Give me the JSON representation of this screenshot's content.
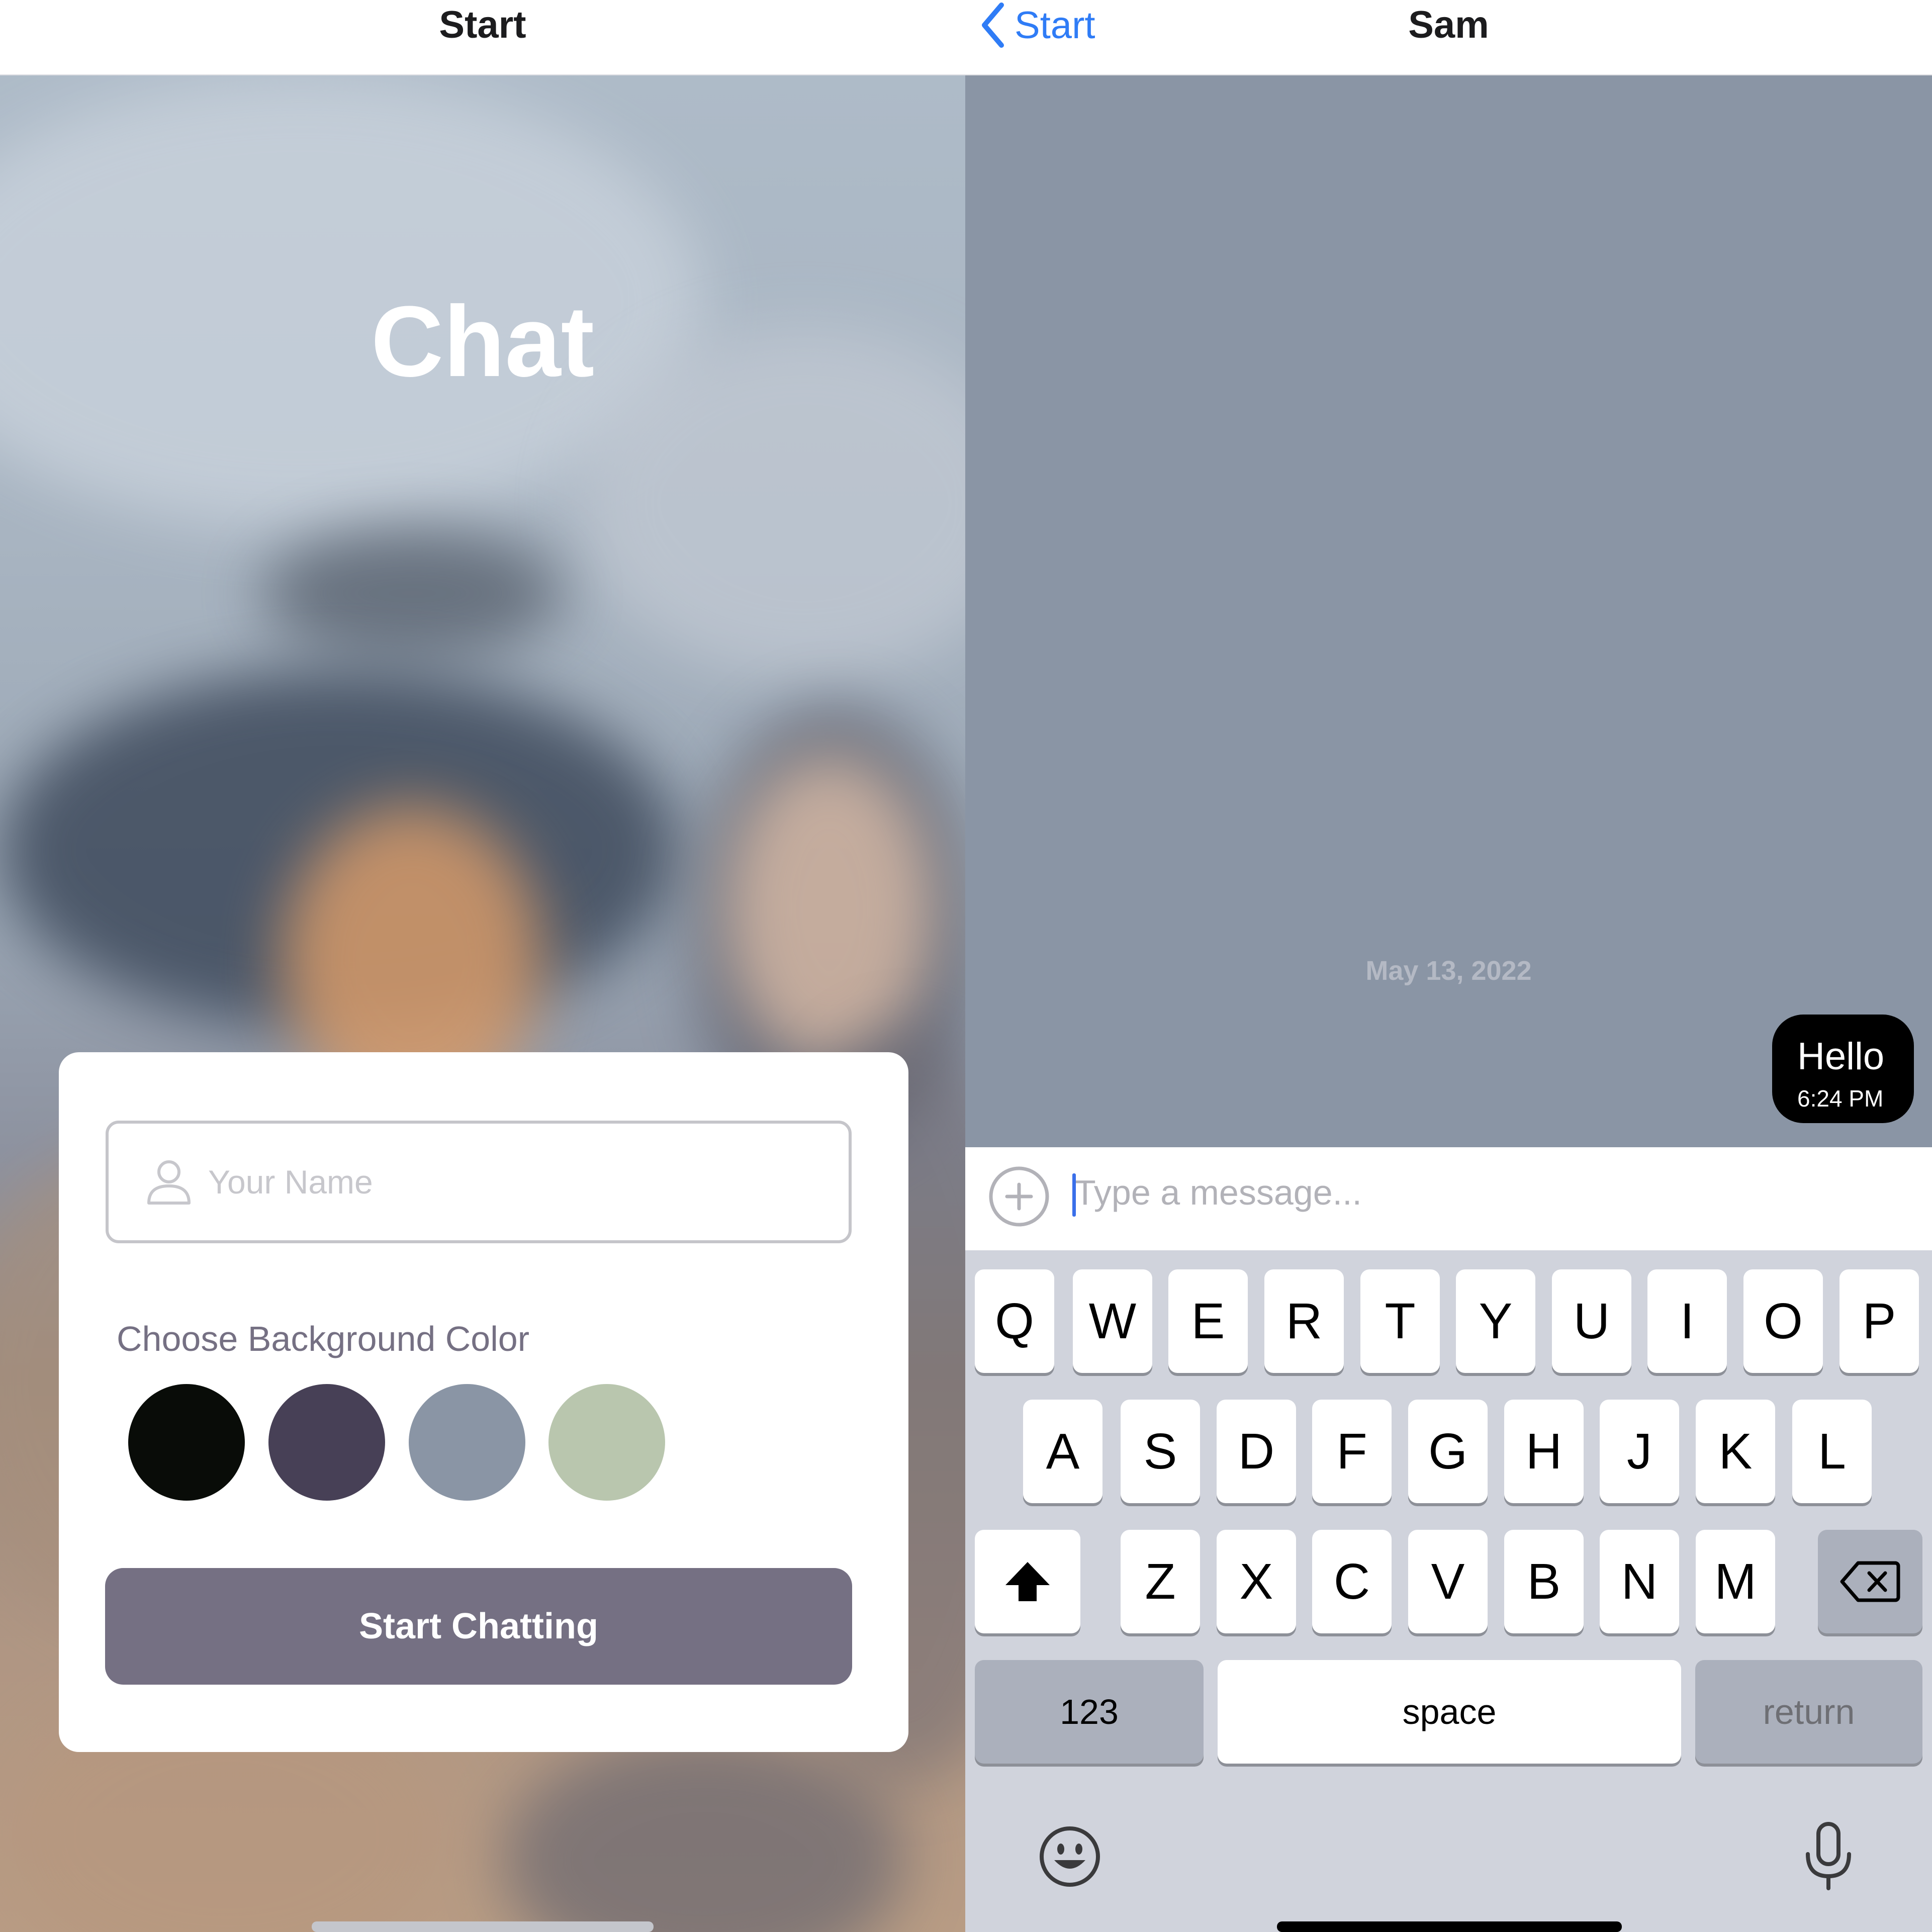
{
  "left": {
    "nav_title": "Start",
    "app_title": "Chat",
    "name_input": {
      "placeholder": "Your Name",
      "value": ""
    },
    "color_label": "Choose Background Color",
    "swatches": [
      {
        "color": "#090C08",
        "name": "black"
      },
      {
        "color": "#474056",
        "name": "dark-purple"
      },
      {
        "color": "#8A95A5",
        "name": "slate-gray"
      },
      {
        "color": "#B9C6AE",
        "name": "sage-green"
      }
    ],
    "start_button_label": "Start Chatting",
    "start_button_color": "#757083"
  },
  "right": {
    "back_label": "Start",
    "nav_title": "Sam",
    "chat_background": "#8A95A5",
    "date": "May 13, 2022",
    "messages": [
      {
        "text": "Hello",
        "time": "6:24 PM",
        "bubble_color": "#000000"
      }
    ],
    "composer_placeholder": "Type a message...",
    "keyboard": {
      "row1": [
        "Q",
        "W",
        "E",
        "R",
        "T",
        "Y",
        "U",
        "I",
        "O",
        "P"
      ],
      "row2": [
        "A",
        "S",
        "D",
        "F",
        "G",
        "H",
        "J",
        "K",
        "L"
      ],
      "row3": [
        "Z",
        "X",
        "C",
        "V",
        "B",
        "N",
        "M"
      ],
      "numbers_label": "123",
      "space_label": "space",
      "return_label": "return"
    }
  },
  "icons": {
    "person": "person-icon",
    "back": "chevron-left-icon",
    "plus": "plus-circle-icon",
    "shift": "shift-icon",
    "delete": "backspace-icon",
    "emoji": "emoji-icon",
    "mic": "microphone-icon"
  }
}
